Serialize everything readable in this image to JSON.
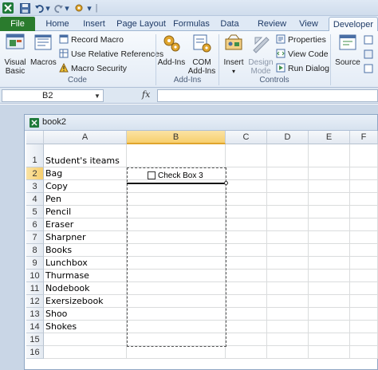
{
  "quick_access": {
    "save_icon": "save-icon",
    "undo_icon": "undo-icon",
    "redo_icon": "redo-icon",
    "customize_icon": "customize-icon"
  },
  "tabs": [
    "File",
    "Home",
    "Insert",
    "Page Layout",
    "Formulas",
    "Data",
    "Review",
    "View",
    "Developer"
  ],
  "ribbon": {
    "code": {
      "visual_basic": "Visual Basic",
      "macros": "Macros",
      "record_macro": "Record Macro",
      "relative_refs": "Use Relative References",
      "macro_security": "Macro Security",
      "label": "Code"
    },
    "addins": {
      "addins": "Add-Ins",
      "com_addins": "COM Add-Ins",
      "label": "Add-Ins"
    },
    "controls": {
      "insert": "Insert",
      "design_mode": "Design Mode",
      "properties": "Properties",
      "view_code": "View Code",
      "run_dialog": "Run Dialog",
      "label": "Controls"
    },
    "xml": {
      "source": "Source"
    }
  },
  "formula_bar": {
    "name_box": "B2",
    "fx": "fx",
    "formula": ""
  },
  "workbook": {
    "title": "book2"
  },
  "grid": {
    "columns": [
      "A",
      "B",
      "C",
      "D",
      "E",
      "F"
    ],
    "rows": [
      "1",
      "2",
      "3",
      "4",
      "5",
      "6",
      "7",
      "8",
      "9",
      "10",
      "11",
      "12",
      "13",
      "14",
      "15",
      "16"
    ],
    "colA": [
      "Student's iteams",
      "Bag",
      "Copy",
      "Pen",
      "Pencil",
      "Eraser",
      "Sharpner",
      "Books",
      "Lunchbox",
      "Thurmase",
      "Nodebook",
      "Exersizebook",
      "Shoo",
      "Shokes",
      "",
      ""
    ],
    "active_cell": "B2",
    "checkbox_label": "Check Box 3"
  },
  "colors": {
    "file_tab": "#2a7b2d",
    "selection_header": "#f7cf6e"
  }
}
